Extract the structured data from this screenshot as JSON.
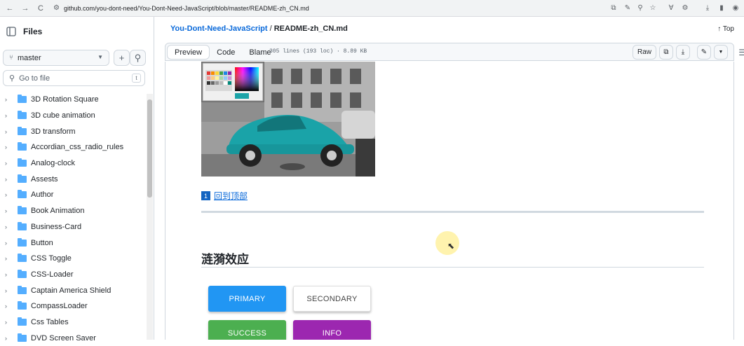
{
  "browser": {
    "url": "github.com/you-dont-need/You-Dont-Need-JavaScript/blob/master/README-zh_CN.md",
    "back": "←",
    "forward": "→",
    "reload": "C"
  },
  "sidebar": {
    "title": "Files",
    "branch": "master",
    "add": "+",
    "search_placeholder": "Go to file",
    "search_kbd": "t",
    "items": [
      "3D Rotation Square",
      "3D cube animation",
      "3D transform",
      "Accordian_css_radio_rules",
      "Analog-clock",
      "Assests",
      "Author",
      "Book Animation",
      "Business-Card",
      "Button",
      "CSS Toggle",
      "CSS-Loader",
      "Captain America Shield",
      "CompassLoader",
      "Css Tables",
      "DVD Screen Saver"
    ]
  },
  "header": {
    "repo": "You-Dont-Need-JavaScript",
    "separator": "/",
    "file": "README-zh_CN.md",
    "top": "↑ Top"
  },
  "filebar": {
    "tabs": [
      "Preview",
      "Code",
      "Blame"
    ],
    "meta": "305 lines (193 loc) · 8.89 KB",
    "raw": "Raw"
  },
  "content": {
    "back_num": "1",
    "back_to_top": "回到顶部",
    "heading": "涟漪效应",
    "buttons": [
      {
        "label": "PRIMARY",
        "color": "#2196f3",
        "text": "#ffffff"
      },
      {
        "label": "SECONDARY",
        "color": "#ffffff",
        "text": "#444444"
      },
      {
        "label": "SUCCESS",
        "color": "#4caf50",
        "text": "#ffffff"
      },
      {
        "label": "INFO",
        "color": "#9c27b0",
        "text": "#ffffff"
      }
    ]
  },
  "colors": {
    "link": "#0969da",
    "folder": "#54aeff",
    "car": "#1aa3a8"
  }
}
